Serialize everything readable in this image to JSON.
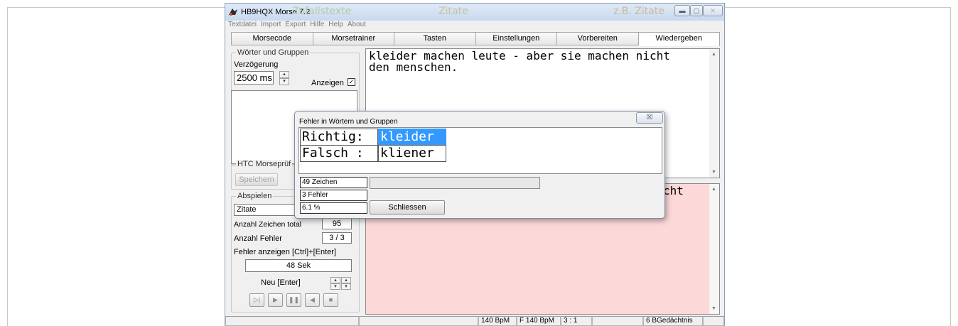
{
  "window": {
    "title": "HB9HQX Morse 7.2",
    "ghost_texts": [
      "Zufallstexte",
      "Zitate",
      "z.B. Zitate"
    ]
  },
  "menu": [
    "Textdatei",
    "Import",
    "Export",
    "Hilfe",
    "Help",
    "About"
  ],
  "tabs": [
    "Morsecode",
    "Morsetrainer",
    "Tasten",
    "Einstellungen",
    "Vorbereiten",
    "Wiedergeben"
  ],
  "left": {
    "group1_title": "Wörter und Gruppen",
    "delay_label": "Verzögerung",
    "delay_value": "2500 ms",
    "show_label": "Anzeigen",
    "show_checked": true,
    "htc_title": "HTC Morseprüf",
    "save_button": "Speichern",
    "play_title": "Abspielen",
    "play_source": "Zitate",
    "total_chars_label": "Anzahl Zeichen total",
    "total_chars_value": "95",
    "errors_label": "Anzahl Fehler",
    "errors_value": "3 / 3",
    "show_errors_label": "Fehler anzeigen   [Ctrl]+[Enter]",
    "timer_value": "48 Sek",
    "new_button": "Neu  [Enter]"
  },
  "main": {
    "text": "kleider machen leute - aber sie machen nicht den menschen.",
    "bottom_text_fragment": "cht"
  },
  "statusbar": [
    "",
    "",
    "140 BpM",
    "F 140 BpM",
    "3 : 1",
    "",
    "6 BGedächtnis",
    ""
  ],
  "dialog": {
    "title": "Fehler in Wörtern und Gruppen",
    "close_glyph": "☒",
    "row1_label": "Richtig:",
    "row1_value": "kleider",
    "row2_label": "Falsch :",
    "row2_value": "kliener",
    "chars_field": "49 Zeichen",
    "errors_field": "3 Fehler",
    "percent_field": "6.1 %",
    "close_button": "Schliessen"
  },
  "colors": {
    "error_bg": "#fdd8d8",
    "selection": "#3399ff",
    "titlebar": "#c8d9ee"
  }
}
